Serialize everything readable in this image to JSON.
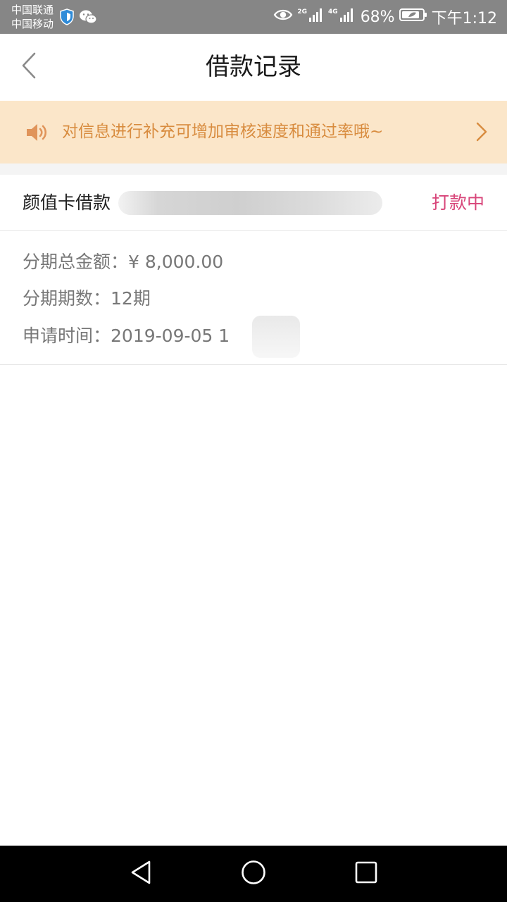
{
  "status_bar": {
    "carrier_1": "中国联通",
    "carrier_2": "中国移动",
    "net_1": "2G",
    "net_2": "4G",
    "battery_percent": "68%",
    "time": "下午1:12",
    "icons": [
      "shield-icon",
      "wechat-icon",
      "eye-icon",
      "signal-icon",
      "battery-icon"
    ]
  },
  "header": {
    "title": "借款记录",
    "back_icon": "chevron-left-icon"
  },
  "notice": {
    "icon": "speaker-icon",
    "text": "对信息进行补充可增加审核速度和通过率哦~",
    "arrow_icon": "chevron-right-icon",
    "color": "#d88c3f",
    "background": "#fbe6c9"
  },
  "record": {
    "product_name": "颜值卡借款",
    "status": "打款中",
    "status_color": "#d8467a",
    "total_amount_label": "分期总金额：",
    "total_amount_value": "¥ 8,000.00",
    "periods_label": "分期期数：",
    "periods_value": "12期",
    "apply_time_label": "申请时间：",
    "apply_time_value": "2019-09-05 1"
  },
  "nav_bar": {
    "icons": [
      "nav-back-icon",
      "nav-home-icon",
      "nav-recent-icon"
    ]
  }
}
